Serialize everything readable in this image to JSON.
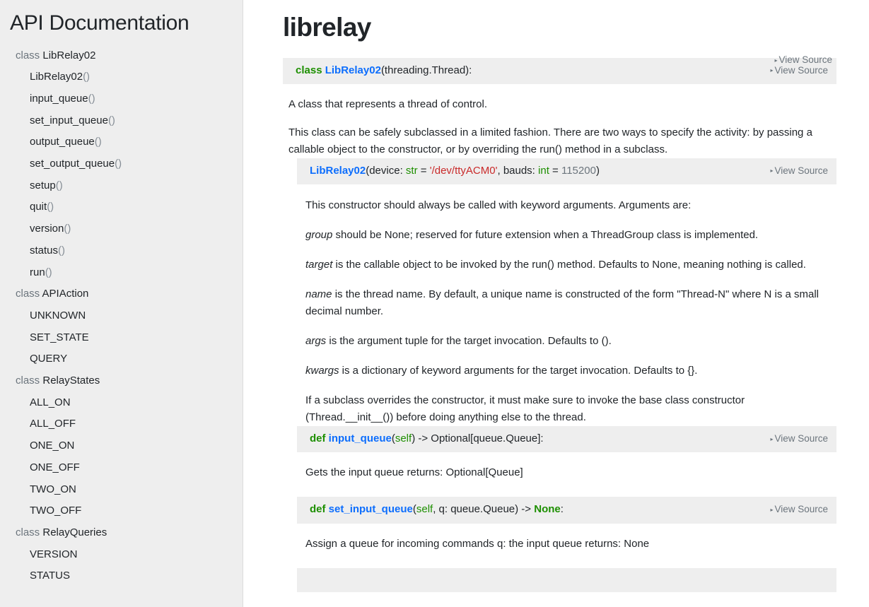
{
  "sidebar": {
    "title": "API Documentation",
    "class_keyword": "class",
    "groups": [
      {
        "keyword": "class",
        "name": "LibRelay02",
        "members": [
          {
            "name": "LibRelay02",
            "suffix": "()"
          },
          {
            "name": "input_queue",
            "suffix": "()"
          },
          {
            "name": "set_input_queue",
            "suffix": "()"
          },
          {
            "name": "output_queue",
            "suffix": "()"
          },
          {
            "name": "set_output_queue",
            "suffix": "()"
          },
          {
            "name": "setup",
            "suffix": "()"
          },
          {
            "name": "quit",
            "suffix": "()"
          },
          {
            "name": "version",
            "suffix": "()"
          },
          {
            "name": "status",
            "suffix": "()"
          },
          {
            "name": "run",
            "suffix": "()"
          }
        ]
      },
      {
        "keyword": "class",
        "name": "APIAction",
        "members": [
          {
            "name": "UNKNOWN",
            "suffix": ""
          },
          {
            "name": "SET_STATE",
            "suffix": ""
          },
          {
            "name": "QUERY",
            "suffix": ""
          }
        ]
      },
      {
        "keyword": "class",
        "name": "RelayStates",
        "members": [
          {
            "name": "ALL_ON",
            "suffix": ""
          },
          {
            "name": "ALL_OFF",
            "suffix": ""
          },
          {
            "name": "ONE_ON",
            "suffix": ""
          },
          {
            "name": "ONE_OFF",
            "suffix": ""
          },
          {
            "name": "TWO_ON",
            "suffix": ""
          },
          {
            "name": "TWO_OFF",
            "suffix": ""
          }
        ]
      },
      {
        "keyword": "class",
        "name": "RelayQueries",
        "members": [
          {
            "name": "VERSION",
            "suffix": ""
          },
          {
            "name": "STATUS",
            "suffix": ""
          }
        ]
      }
    ]
  },
  "main": {
    "module_title": "librelay",
    "view_source_label": "View Source",
    "view_source_marker": "▸",
    "class_signature": {
      "keyword": "class",
      "name": "LibRelay02",
      "bases": "(threading.Thread):"
    },
    "class_doc": [
      "A class that represents a thread of control.",
      "This class can be safely subclassed in a limited fashion. There are two ways to specify the activity: by passing a callable object to the constructor, or by overriding the run() method in a subclass."
    ],
    "constructor": {
      "name": "LibRelay02",
      "open_paren": "(",
      "param1_name": "device: ",
      "param1_type": "str",
      "param1_eq": " = ",
      "param1_default": "'/dev/ttyACM0'",
      "param2_sep": ", ",
      "param2_name": "bauds: ",
      "param2_type": "int",
      "param2_eq": " = ",
      "param2_default": "115200",
      "close_paren": ")",
      "docs": [
        {
          "lead": "",
          "text": "This constructor should always be called with keyword arguments. Arguments are:"
        },
        {
          "lead": "group",
          "text": " should be None; reserved for future extension when a ThreadGroup class is implemented."
        },
        {
          "lead": "target",
          "text": " is the callable object to be invoked by the run() method. Defaults to None, meaning nothing is called."
        },
        {
          "lead": "name",
          "text": " is the thread name. By default, a unique name is constructed of the form \"Thread-N\" where N is a small decimal number."
        },
        {
          "lead": "args",
          "text": " is the argument tuple for the target invocation. Defaults to ()."
        },
        {
          "lead": "kwargs",
          "text": " is a dictionary of keyword arguments for the target invocation. Defaults to {}."
        },
        {
          "lead": "",
          "text": "If a subclass overrides the constructor, it must make sure to invoke the base class constructor (Thread.__init__()) before doing anything else to the thread."
        }
      ]
    },
    "methods": [
      {
        "keyword": "def",
        "name": "input_queue",
        "open_paren": "(",
        "self": "self",
        "params_rest": "",
        "close_paren": ")",
        "arrow": " -> ",
        "return_type": "Optional[queue.Queue]",
        "return_type_is_none": false,
        "colon": ":",
        "doc": "Gets the input queue returns: Optional[Queue]"
      },
      {
        "keyword": "def",
        "name": "set_input_queue",
        "open_paren": "(",
        "self": "self",
        "params_rest": ", q: queue.Queue",
        "close_paren": ")",
        "arrow": " -> ",
        "return_type": "None",
        "return_type_is_none": true,
        "colon": ":",
        "doc": "Assign a queue for incoming commands q: the input queue returns: None"
      }
    ]
  }
}
